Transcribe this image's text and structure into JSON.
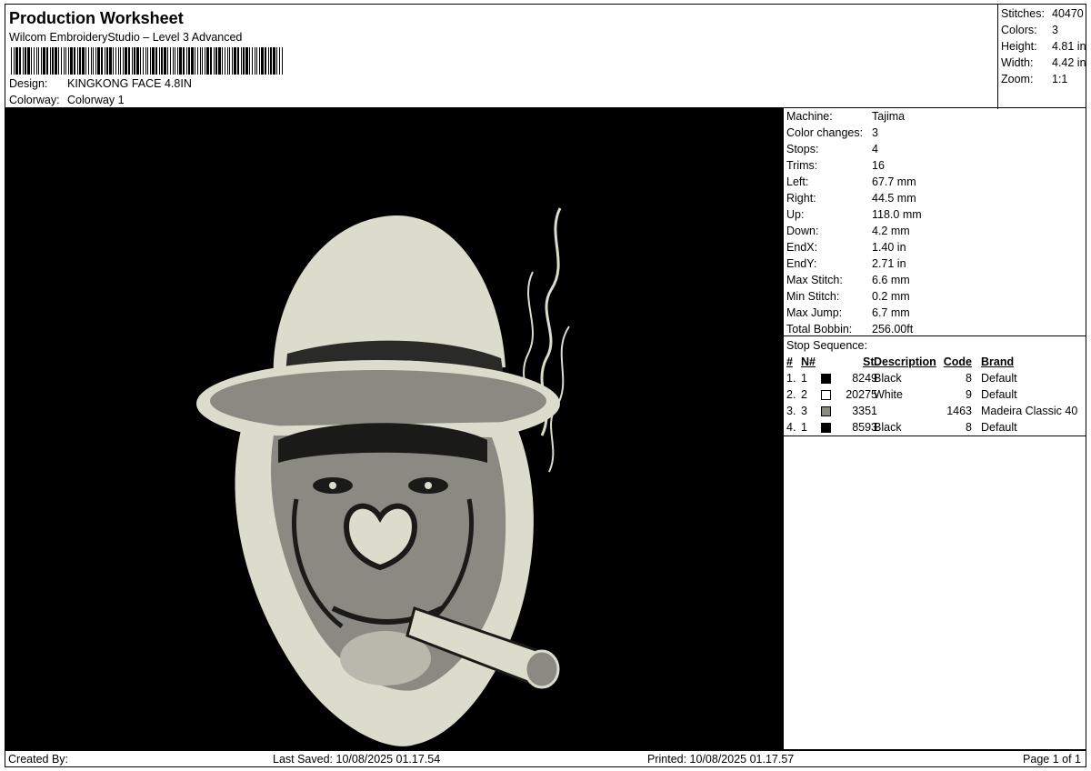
{
  "header": {
    "title": "Production Worksheet",
    "software": "Wilcom EmbroideryStudio – Level 3 Advanced",
    "design_label": "Design:",
    "design_value": "KINGKONG FACE 4.8IN",
    "colorway_label": "Colorway:",
    "colorway_value": "Colorway 1"
  },
  "summary": [
    {
      "label": "Stitches:",
      "value": "40470"
    },
    {
      "label": "Colors:",
      "value": "3"
    },
    {
      "label": "Height:",
      "value": "4.81 in"
    },
    {
      "label": "Width:",
      "value": "4.42 in"
    },
    {
      "label": "Zoom:",
      "value": "1:1"
    }
  ],
  "machine_info": [
    {
      "label": "Machine:",
      "value": "Tajima"
    },
    {
      "label": "Color changes:",
      "value": "3"
    },
    {
      "label": "Stops:",
      "value": "4"
    },
    {
      "label": "Trims:",
      "value": "16"
    },
    {
      "label": "Left:",
      "value": "67.7 mm"
    },
    {
      "label": "Right:",
      "value": "44.5 mm"
    },
    {
      "label": "Up:",
      "value": "118.0 mm"
    },
    {
      "label": "Down:",
      "value": "4.2 mm"
    },
    {
      "label": "EndX:",
      "value": "1.40 in"
    },
    {
      "label": "EndY:",
      "value": "2.71 in"
    },
    {
      "label": "Max Stitch:",
      "value": "6.6 mm"
    },
    {
      "label": "Min Stitch:",
      "value": "0.2 mm"
    },
    {
      "label": "Max Jump:",
      "value": "6.7 mm"
    },
    {
      "label": "Total Bobbin:",
      "value": "256.00ft"
    }
  ],
  "stop_sequence": {
    "title": "Stop Sequence:",
    "headers": {
      "num": "#",
      "n": "N#",
      "st": "St.",
      "desc": "Description",
      "code": "Code",
      "brand": "Brand"
    },
    "rows": [
      {
        "num": "1.",
        "n": "1",
        "swatch": "#000000",
        "st": "8249",
        "desc": "Black",
        "code": "8",
        "brand": "Default"
      },
      {
        "num": "2.",
        "n": "2",
        "swatch": "#ffffff",
        "st": "20275",
        "desc": "White",
        "code": "9",
        "brand": "Default"
      },
      {
        "num": "3.",
        "n": "3",
        "swatch": "#8a8a82",
        "st": "3351",
        "desc": "",
        "code": "1463",
        "brand": "Madeira Classic 40"
      },
      {
        "num": "4.",
        "n": "1",
        "swatch": "#000000",
        "st": "8593",
        "desc": "Black",
        "code": "8",
        "brand": "Default"
      }
    ]
  },
  "footer": {
    "created_by": "Created By:",
    "last_saved": "Last Saved: 10/08/2025 01.17.54",
    "printed": "Printed: 10/08/2025 01.17.57",
    "page": "Page 1 of 1"
  },
  "colors": {
    "canvas_bg": "#000000",
    "thread_light": "#dcdccc",
    "thread_mid": "#8a8a82"
  }
}
